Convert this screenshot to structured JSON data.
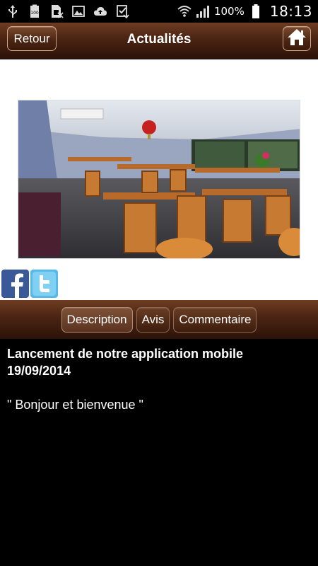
{
  "status_bar": {
    "battery_percent": "100%",
    "time": "18:13",
    "icons": [
      "usb-icon",
      "battery-100-icon",
      "sim-icon",
      "image-icon",
      "cloud-upload-icon",
      "check-download-icon",
      "wifi-icon",
      "signal-icon",
      "battery-icon"
    ]
  },
  "header": {
    "back_label": "Retour",
    "title": "Actualités",
    "home_icon": "home-icon"
  },
  "social": {
    "icons": [
      "facebook-icon",
      "twitter-icon"
    ]
  },
  "tabs": [
    {
      "label": "Description",
      "active": true
    },
    {
      "label": "Avis",
      "active": false
    },
    {
      "label": "Commentaire",
      "active": false
    }
  ],
  "article": {
    "title": "Lancement de notre application mobile",
    "date": "19/09/2014",
    "body": "\" Bonjour et bienvenue \""
  },
  "colors": {
    "header_brown": "#4e2614",
    "button_border": "#c9a58a",
    "background": "#000000",
    "content_bg": "#ffffff"
  }
}
